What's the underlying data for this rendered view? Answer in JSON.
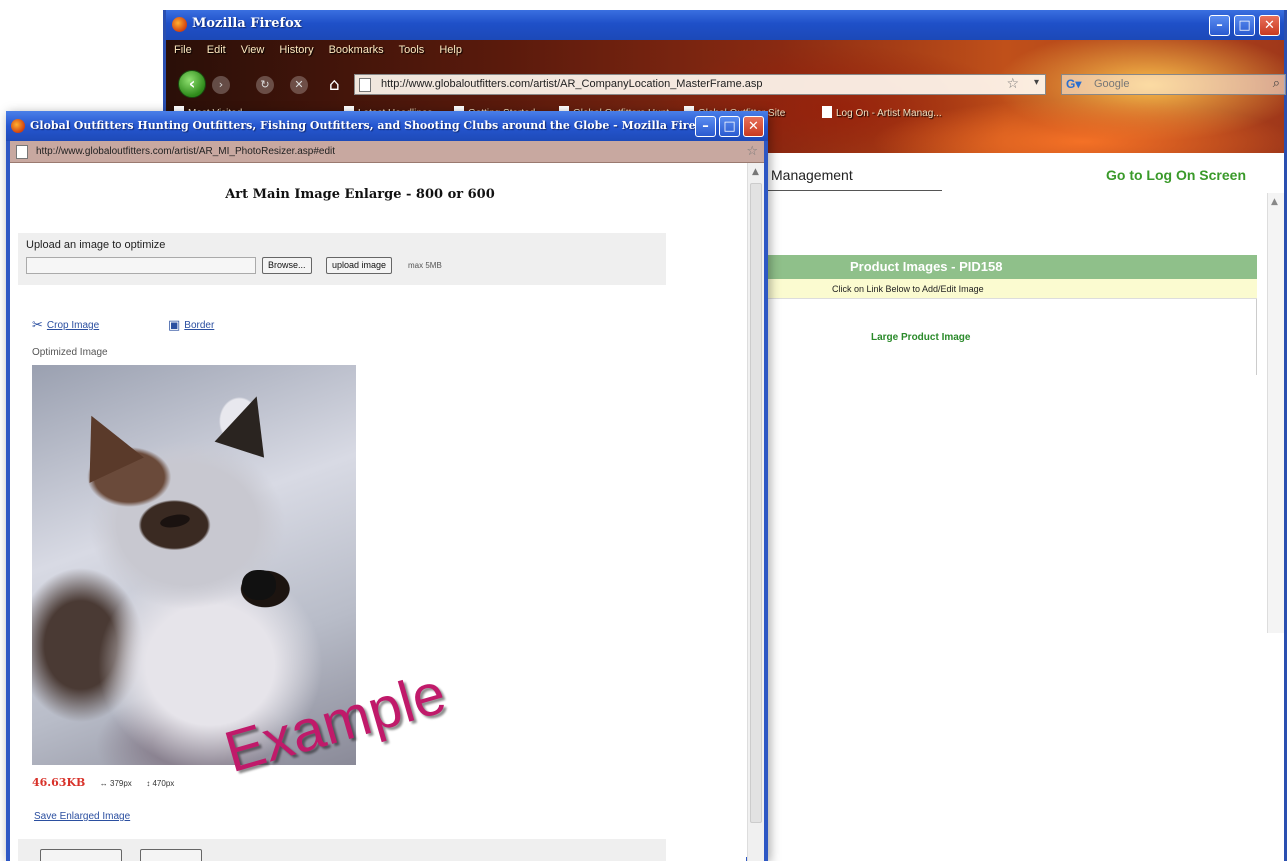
{
  "back_window": {
    "title": "Mozilla Firefox",
    "menu": [
      "File",
      "Edit",
      "View",
      "History",
      "Bookmarks",
      "Tools",
      "Help"
    ],
    "url": "http://www.globaloutfitters.com/artist/AR_CompanyLocation_MasterFrame.asp",
    "search_placeholder": "Google",
    "bookmarks": [
      "Most Visited",
      "Latest Headlines",
      "Getting Started",
      "Global Outfitters Hunt",
      "Global Outfitter Site",
      "Log On - Artist Manag..."
    ],
    "page": {
      "management": "Management",
      "go_to_logon": "Go to Log On Screen",
      "product_images_header": "Product Images - PID158",
      "product_images_sub": "Click on Link Below to Add/Edit Image",
      "large_product_image": "Large Product Image"
    }
  },
  "popup": {
    "title": "Global Outfitters Hunting Outfitters, Fishing Outfitters, and Shooting Clubs around the Globe - Mozilla Firefox",
    "url": "http://www.globaloutfitters.com/artist/AR_MI_PhotoResizer.asp#edit",
    "heading": "Art Main Image Enlarge - 800 or 600",
    "upload_label": "Upload an image to optimize",
    "browse_button": "Browse...",
    "upload_button": "upload image",
    "max_size": "max 5MB",
    "crop_label": "Crop Image",
    "border_label": "Border",
    "optimized_label": "Optimized Image",
    "watermark": "Example",
    "size_kb": "46.63KB",
    "width_px": "↔ 379px",
    "height_px": "↕ 470px",
    "save_link": "Save Enlarged Image"
  }
}
